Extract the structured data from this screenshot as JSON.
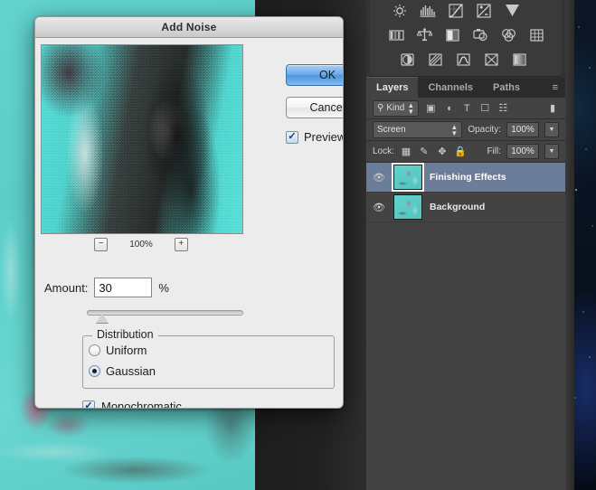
{
  "dialog": {
    "title": "Add Noise",
    "buttons": {
      "ok": "OK",
      "cancel": "Cancel"
    },
    "preview_checkbox": {
      "label": "Preview",
      "checked": true
    },
    "zoom": {
      "minus": "−",
      "level": "100%",
      "plus": "+"
    },
    "amount": {
      "label": "Amount:",
      "value": "30",
      "unit": "%"
    },
    "distribution": {
      "legend": "Distribution",
      "options": [
        {
          "label": "Uniform",
          "selected": false
        },
        {
          "label": "Gaussian",
          "selected": true
        }
      ]
    },
    "monochromatic": {
      "label": "Monochromatic",
      "checked": true
    }
  },
  "adjustments_panel": {
    "row1": [
      "brightness-contrast-icon",
      "levels-icon",
      "curves-icon",
      "exposure-icon",
      "vibrance-icon"
    ],
    "row2": [
      "hue-saturation-icon",
      "color-balance-icon",
      "black-white-icon",
      "photo-filter-icon",
      "channel-mixer-icon",
      "color-lookup-icon"
    ],
    "row3": [
      "invert-icon",
      "posterize-icon",
      "threshold-icon",
      "gradient-map-icon",
      "selective-color-icon"
    ]
  },
  "layers_panel": {
    "tabs": [
      {
        "label": "Layers",
        "active": true
      },
      {
        "label": "Channels",
        "active": false
      },
      {
        "label": "Paths",
        "active": false
      }
    ],
    "panel_menu": "≡",
    "filter": {
      "kind_label": "Kind",
      "search_icon": "search-icon",
      "type_filters": [
        "pixel-layer-icon",
        "adjustment-layer-icon",
        "type-layer-icon",
        "shape-layer-icon",
        "smart-object-icon"
      ],
      "toggle_icon": "filter-toggle-icon"
    },
    "blend": {
      "mode": "Screen",
      "opacity_label": "Opacity:",
      "opacity_value": "100%"
    },
    "lock": {
      "label": "Lock:",
      "icons": [
        "lock-transparency-icon",
        "lock-pixels-icon",
        "lock-position-icon",
        "lock-all-icon"
      ],
      "fill_label": "Fill:",
      "fill_value": "100%"
    },
    "layers": [
      {
        "name": "Finishing Effects",
        "visible": true,
        "selected": true
      },
      {
        "name": "Background",
        "visible": true,
        "selected": false
      }
    ]
  },
  "colors": {
    "accent_blue": "#4f96e0",
    "dialog_bg": "#ececec",
    "panel_bg": "#434343",
    "layer_selected": "#6b7d99",
    "canvas_teal": "#5ccfca"
  }
}
